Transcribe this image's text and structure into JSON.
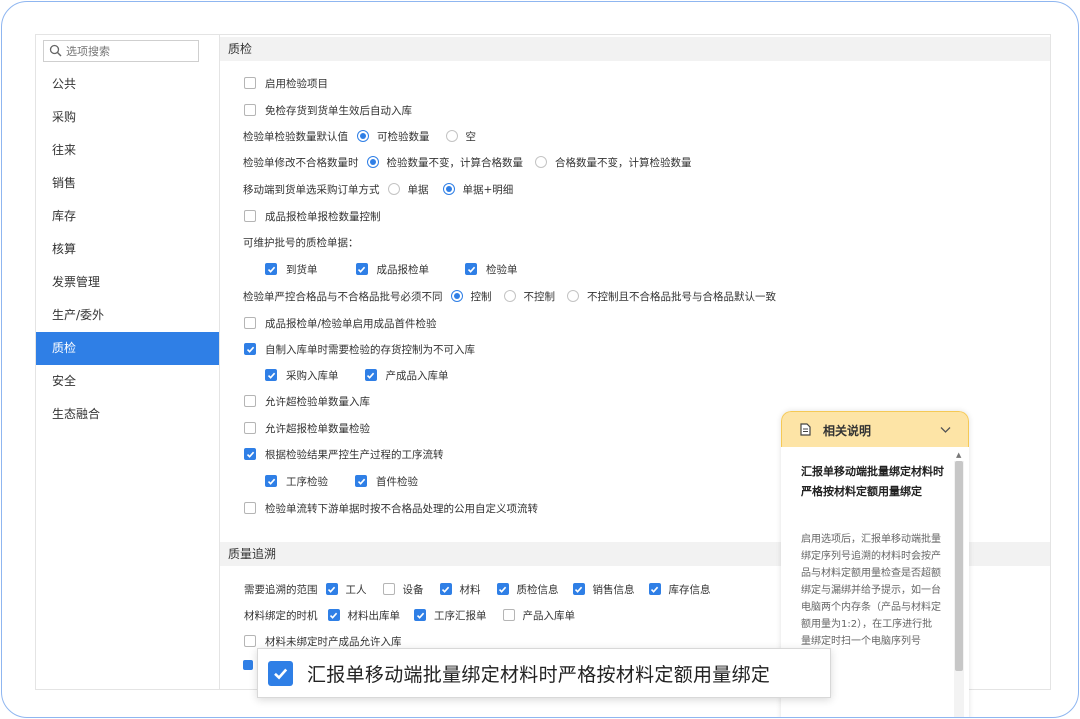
{
  "search": {
    "placeholder": "选项搜索"
  },
  "sidebar": {
    "items": [
      {
        "label": "公共"
      },
      {
        "label": "采购"
      },
      {
        "label": "往来"
      },
      {
        "label": "销售"
      },
      {
        "label": "库存"
      },
      {
        "label": "核算"
      },
      {
        "label": "发票管理"
      },
      {
        "label": "生产/委外"
      },
      {
        "label": "质检",
        "active": true
      },
      {
        "label": "安全"
      },
      {
        "label": "生态融合"
      }
    ]
  },
  "qc": {
    "title": "质检",
    "enable": "启用检验项目",
    "auto_in": "免检存货到货单生效后自动入库",
    "default_qty": {
      "label": "检验单检验数量默认值",
      "options": [
        "可检验数量",
        "空"
      ],
      "selected": 0
    },
    "modify_unqualified": {
      "label": "检验单修改不合格数量时",
      "options": [
        "检验数量不变，计算合格数量",
        "合格数量不变，计算检验数量"
      ],
      "selected": 0
    },
    "mobile_po": {
      "label": "移动端到货单选采购订单方式",
      "options": [
        "单据",
        "单据+明细"
      ],
      "selected": 1
    },
    "finished_qty_ctrl": "成品报检单报检数量控制",
    "batch_label": "可维护批号的质检单据：",
    "batch_docs": [
      "到货单",
      "成品报检单",
      "检验单"
    ],
    "batch_strict": {
      "label": "检验单严控合格品与不合格品批号必须不同",
      "options": [
        "控制",
        "不控制",
        "不控制且不合格品批号与合格品默认一致"
      ],
      "selected": 0
    },
    "first_piece": "成品报检单/检验单启用成品首件检验",
    "self_made": "自制入库单时需要检验的存货控制为不可入库",
    "self_made_sub": [
      "采购入库单",
      "产成品入库单"
    ],
    "allow_over_in": "允许超检验单数量入库",
    "allow_over_check": "允许超报检单数量检验",
    "strict_flow": "根据检验结果严控生产过程的工序流转",
    "strict_flow_sub": [
      "工序检验",
      "首件检验"
    ],
    "downstream": "检验单流转下游单据时按不合格品处理的公用自定义项流转"
  },
  "trace": {
    "title": "质量追溯",
    "scope_label": "需要追溯的范围",
    "scope": [
      {
        "label": "工人",
        "checked": true
      },
      {
        "label": "设备",
        "checked": false
      },
      {
        "label": "材料",
        "checked": true
      },
      {
        "label": "质检信息",
        "checked": true
      },
      {
        "label": "销售信息",
        "checked": true
      },
      {
        "label": "库存信息",
        "checked": true
      }
    ],
    "bind_label": "材料绑定的时机",
    "bind": [
      {
        "label": "材料出库单",
        "checked": true
      },
      {
        "label": "工序汇报单",
        "checked": true
      },
      {
        "label": "产品入库单",
        "checked": false
      }
    ],
    "unbound_allow": "材料未绑定时产成品允许入库"
  },
  "help": {
    "header": "相关说明",
    "title": "汇报单移动端批量绑定材料时严格按材料定额用量绑定",
    "desc": "启用选项后，汇报单移动端批量绑定序列号追溯的材料时会按产品与材料定额用量检查是否超额绑定与漏绑并给予提示，如一台电脑两个内存条（产品与材料定额用量为1:2），在工序进行批量绑定时扫一个电脑序列号"
  },
  "callout": {
    "label": "汇报单移动端批量绑定材料时严格按材料定额用量绑定"
  },
  "colors": {
    "accent": "#2f7fe6",
    "help_header": "#fde4a6",
    "frame": "#8fb6f0"
  }
}
